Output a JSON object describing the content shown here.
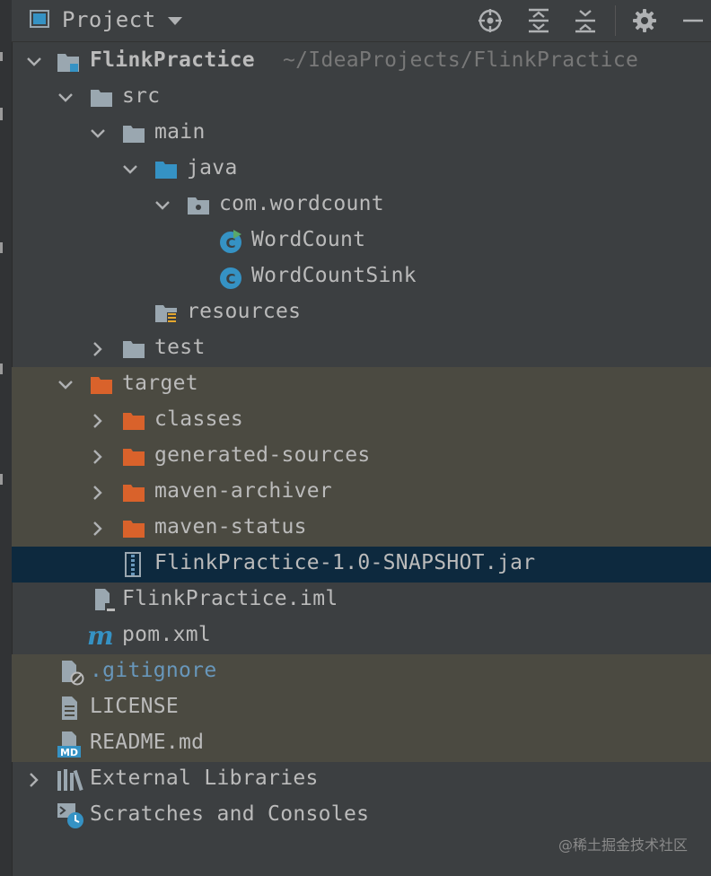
{
  "header": {
    "title": "Project",
    "icons": [
      "locate-icon",
      "expand-all-icon",
      "collapse-all-icon",
      "settings-icon",
      "hide-icon"
    ]
  },
  "tree": [
    {
      "label": "FlinkPractice",
      "path": "~/IdeaProjects/FlinkPractice",
      "icon": "module-folder-icon",
      "expanded": true,
      "depth": 0
    },
    {
      "label": "src",
      "icon": "folder-icon",
      "expanded": true,
      "depth": 1
    },
    {
      "label": "main",
      "icon": "folder-icon",
      "expanded": true,
      "depth": 2
    },
    {
      "label": "java",
      "icon": "source-folder-icon",
      "expanded": true,
      "depth": 3
    },
    {
      "label": "com.wordcount",
      "icon": "package-icon",
      "expanded": true,
      "depth": 4
    },
    {
      "label": "WordCount",
      "icon": "runnable-class-icon",
      "depth": 5
    },
    {
      "label": "WordCountSink",
      "icon": "class-icon",
      "depth": 5
    },
    {
      "label": "resources",
      "icon": "resources-folder-icon",
      "depth": 4
    },
    {
      "label": "test",
      "icon": "folder-icon",
      "expanded": false,
      "depth": 2
    },
    {
      "label": "target",
      "icon": "excluded-folder-icon",
      "expanded": true,
      "depth": 1
    },
    {
      "label": "classes",
      "icon": "excluded-folder-icon",
      "expanded": false,
      "depth": 2
    },
    {
      "label": "generated-sources",
      "icon": "excluded-folder-icon",
      "expanded": false,
      "depth": 2
    },
    {
      "label": "maven-archiver",
      "icon": "excluded-folder-icon",
      "expanded": false,
      "depth": 2
    },
    {
      "label": "maven-status",
      "icon": "excluded-folder-icon",
      "expanded": false,
      "depth": 2
    },
    {
      "label": "FlinkPractice-1.0-SNAPSHOT.jar",
      "icon": "jar-icon",
      "depth": 3,
      "selected": true
    },
    {
      "label": "FlinkPractice.iml",
      "icon": "iml-file-icon",
      "depth": 2
    },
    {
      "label": "pom.xml",
      "icon": "maven-icon",
      "depth": 2
    },
    {
      "label": ".gitignore",
      "icon": "ignore-file-icon",
      "depth": 1
    },
    {
      "label": "LICENSE",
      "icon": "text-file-icon",
      "depth": 1
    },
    {
      "label": "README.md",
      "icon": "markdown-icon",
      "depth": 1
    },
    {
      "label": "External Libraries",
      "icon": "libraries-icon",
      "expanded": false,
      "depth": 0
    },
    {
      "label": "Scratches and Consoles",
      "icon": "scratches-icon",
      "depth": 0
    }
  ],
  "colors": {
    "background": "#3c3f41",
    "excluded_row": "#4b4a41",
    "selected_row": "#0d293e",
    "excluded_folder": "#d9622b",
    "source_folder": "#3592c4",
    "class_icon": "#3592c4",
    "run_badge": "#59a869"
  },
  "watermark": "@稀土掘金技术社区"
}
